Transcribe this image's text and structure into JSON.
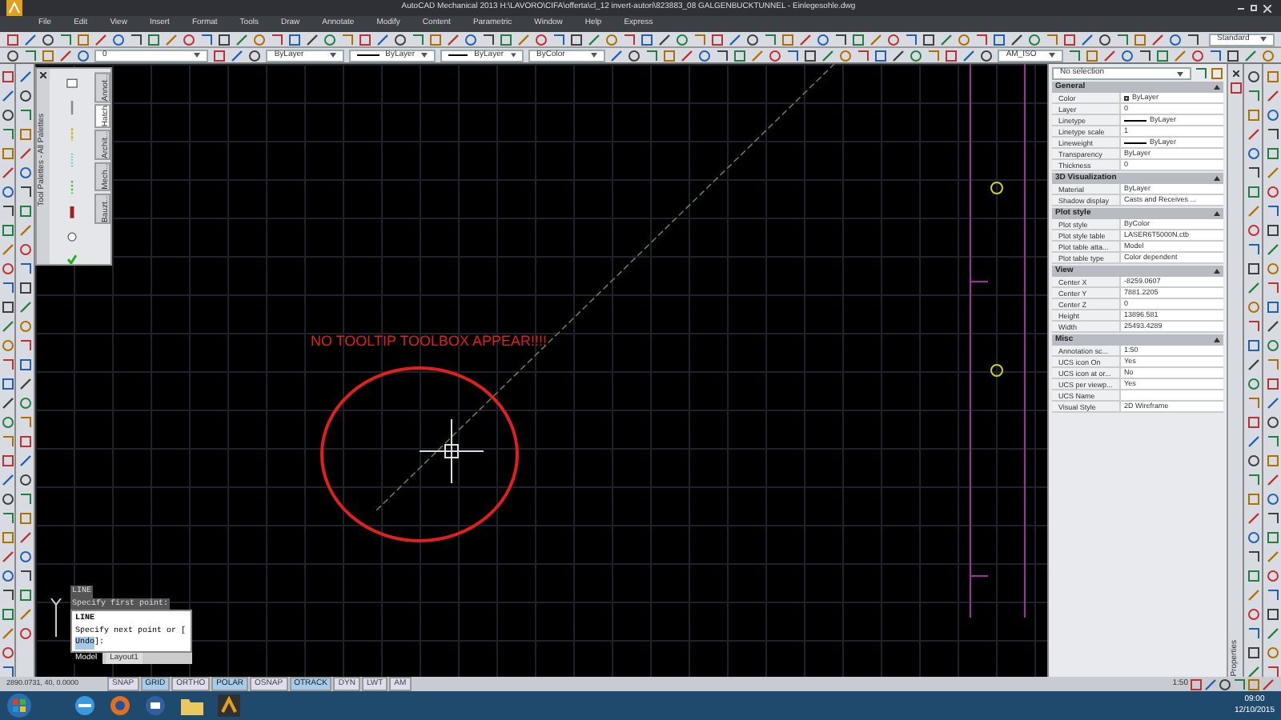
{
  "window": {
    "title": "AutoCAD Mechanical 2013   H:\\LAVORO\\CIFA\\offerta\\cl_12 invert-autori\\823883_08 GALGENBUCKTUNNEL - Einlegesohle.dwg"
  },
  "menu": [
    "File",
    "Edit",
    "View",
    "Insert",
    "Format",
    "Tools",
    "Draw",
    "Annotate",
    "Modify",
    "Content",
    "Parametric",
    "Window",
    "Help",
    "Express"
  ],
  "toolbar": {
    "text_style": "Standard",
    "layer": "0",
    "color_setting": "ByLayer",
    "linetype": "ByLayer",
    "lineweight": "ByLayer",
    "plot_style": "ByColor",
    "dim_style": "AM_ISO"
  },
  "tool_palette": {
    "title": "Tool Palettes - All Palettes",
    "tabs": [
      {
        "label": "Annot...",
        "selected": false
      },
      {
        "label": "Hatch",
        "selected": true
      },
      {
        "label": "Archit...",
        "selected": false
      },
      {
        "label": "Mech...",
        "selected": false
      },
      {
        "label": "Bauzt...",
        "selected": false
      }
    ]
  },
  "annotation": "NO TOOLTIP TOOLBOX APPEAR!!!!",
  "command": {
    "history": [
      "LINE",
      "Specify first point:"
    ],
    "popup_title": "LINE",
    "prompt": "Specify next point or [",
    "option": "Undo",
    "prompt_end": "]:"
  },
  "layout_tabs": [
    {
      "label": "Model",
      "selected": true
    },
    {
      "label": "Layout1",
      "selected": false
    }
  ],
  "properties": {
    "selection": "No selection",
    "side_label": "Properties",
    "sections": [
      {
        "title": "General",
        "expanded": true,
        "rows": [
          {
            "name": "Color",
            "value": "ByLayer",
            "kind": "swatch"
          },
          {
            "name": "Layer",
            "value": "0"
          },
          {
            "name": "Linetype",
            "value": "ByLayer",
            "kind": "line"
          },
          {
            "name": "Linetype scale",
            "value": "1"
          },
          {
            "name": "Lineweight",
            "value": "ByLayer",
            "kind": "line"
          },
          {
            "name": "Transparency",
            "value": "ByLayer"
          },
          {
            "name": "Thickness",
            "value": "0"
          }
        ]
      },
      {
        "title": "3D Visualization",
        "expanded": true,
        "rows": [
          {
            "name": "Material",
            "value": "ByLayer"
          },
          {
            "name": "Shadow display",
            "value": "Casts and Receives ..."
          }
        ]
      },
      {
        "title": "Plot style",
        "expanded": true,
        "rows": [
          {
            "name": "Plot style",
            "value": "ByColor"
          },
          {
            "name": "Plot style table",
            "value": "LASER6T5000N.ctb"
          },
          {
            "name": "Plot table atta...",
            "value": "Model"
          },
          {
            "name": "Plot table type",
            "value": "Color dependent"
          }
        ]
      },
      {
        "title": "View",
        "expanded": true,
        "rows": [
          {
            "name": "Center X",
            "value": "-8259.0607"
          },
          {
            "name": "Center Y",
            "value": "7881.2205"
          },
          {
            "name": "Center Z",
            "value": "0"
          },
          {
            "name": "Height",
            "value": "13896.581"
          },
          {
            "name": "Width",
            "value": "25493.4289"
          }
        ]
      },
      {
        "title": "Misc",
        "expanded": true,
        "rows": [
          {
            "name": "Annotation sc...",
            "value": "1:50"
          },
          {
            "name": "UCS icon On",
            "value": "Yes"
          },
          {
            "name": "UCS icon at or...",
            "value": "No"
          },
          {
            "name": "UCS per viewp...",
            "value": "Yes"
          },
          {
            "name": "UCS Name"
          },
          {
            "name": "Visual Style",
            "value": "2D Wireframe"
          }
        ]
      }
    ]
  },
  "status_bar": {
    "coordinates": "2890.0731, 40, 0.0000",
    "toggles": [
      {
        "label": "SNAP",
        "on": false
      },
      {
        "label": "GRID",
        "on": true
      },
      {
        "label": "ORTHO",
        "on": false
      },
      {
        "label": "POLAR",
        "on": true
      },
      {
        "label": "OSNAP",
        "on": false
      },
      {
        "label": "OTRACK",
        "on": true
      },
      {
        "label": "DYN",
        "on": false
      },
      {
        "label": "LWT",
        "on": false
      },
      {
        "label": "AM",
        "on": false
      }
    ],
    "scale": "1:50"
  },
  "taskbar": {
    "time": "09:00",
    "date": "12/10/2015"
  }
}
